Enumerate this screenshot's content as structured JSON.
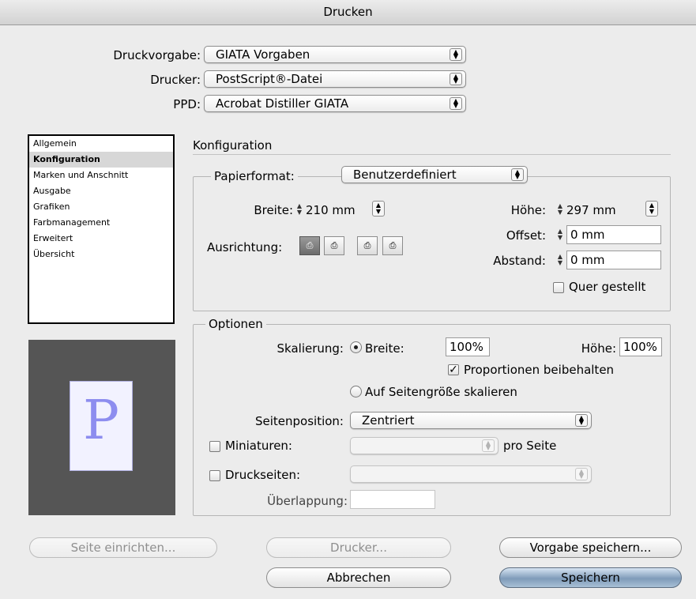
{
  "window": {
    "title": "Drucken"
  },
  "presets": {
    "druckvorgabe_label": "Druckvorgabe:",
    "druckvorgabe_value": "GIATA Vorgaben",
    "drucker_label": "Drucker:",
    "drucker_value": "PostScript®-Datei",
    "ppd_label": "PPD:",
    "ppd_value": "Acrobat Distiller GIATA"
  },
  "sidebar": {
    "items": [
      {
        "label": "Allgemein",
        "selected": false
      },
      {
        "label": "Konfiguration",
        "selected": true
      },
      {
        "label": "Marken und Anschnitt",
        "selected": false
      },
      {
        "label": "Ausgabe",
        "selected": false
      },
      {
        "label": "Grafiken",
        "selected": false
      },
      {
        "label": "Farbmanagement",
        "selected": false
      },
      {
        "label": "Erweitert",
        "selected": false
      },
      {
        "label": "Übersicht",
        "selected": false
      }
    ]
  },
  "preview": {
    "glyph": "P"
  },
  "section": {
    "title": "Konfiguration"
  },
  "paper": {
    "format_label": "Papierformat:",
    "format_value": "Benutzerdefiniert",
    "width_label": "Breite:",
    "width_value": "210 mm",
    "height_label": "Höhe:",
    "height_value": "297 mm",
    "offset_label": "Offset:",
    "offset_value": "0 mm",
    "gap_label": "Abstand:",
    "gap_value": "0 mm",
    "orientation_label": "Ausrichtung:",
    "transverse_label": "Quer gestellt",
    "transverse_checked": false
  },
  "options": {
    "title": "Optionen",
    "scaling_label": "Skalierung:",
    "scale_width_label": "Breite:",
    "scale_width_value": "100%",
    "scale_height_label": "Höhe:",
    "scale_height_value": "100%",
    "proportions_label": "Proportionen beibehalten",
    "proportions_checked": true,
    "fit_page_label": "Auf Seitengröße skalieren",
    "page_position_label": "Seitenposition:",
    "page_position_value": "Zentriert",
    "thumbnails_label": "Miniaturen:",
    "per_page_label": "pro Seite",
    "tiles_label": "Druckseiten:",
    "overlap_label": "Überlappung:"
  },
  "buttons": {
    "page_setup": "Seite einrichten...",
    "printer": "Drucker...",
    "save_preset": "Vorgabe speichern...",
    "cancel": "Abbrechen",
    "save": "Speichern"
  }
}
